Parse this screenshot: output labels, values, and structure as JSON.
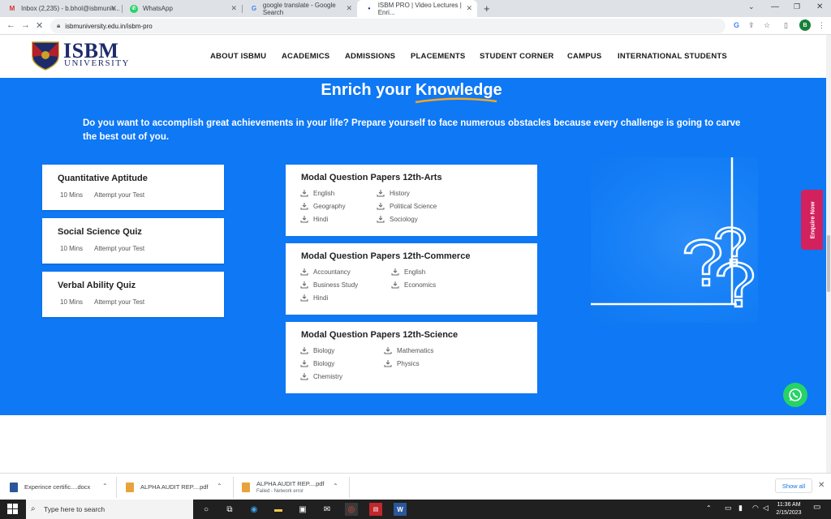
{
  "browser": {
    "tabs": [
      {
        "label": "Inbox (2,235) - b.bhol@isbmuniv...",
        "icon": "gmail-icon"
      },
      {
        "label": "WhatsApp",
        "icon": "whatsapp-icon"
      },
      {
        "label": "google translate - Google Search",
        "icon": "google-icon"
      },
      {
        "label": "ISBM PRO | Video Lectures | Enri...",
        "icon": "isbm-icon"
      }
    ],
    "url": "isbmuniversity.edu.in/isbm-pro",
    "profile_initial": "B"
  },
  "site": {
    "logo_text": "ISBM",
    "logo_sub": "UNIVERSITY",
    "nav": [
      "ABOUT ISBMU",
      "ACADEMICS",
      "ADMISSIONS",
      "PLACEMENTS",
      "STUDENT CORNER",
      "CAMPUS",
      "INTERNATIONAL STUDENTS"
    ]
  },
  "main": {
    "heading_pre": "Enrich your ",
    "heading_word": "Knowledge",
    "intro": "Do you want to accomplish great achievements in your life? Prepare yourself to face numerous obstacles because every challenge is going to carve the best out of you.",
    "quizzes": [
      {
        "title": "Quantitative Aptitude",
        "duration": "10 Mins",
        "action": "Attempt your Test"
      },
      {
        "title": "Social Science Quiz",
        "duration": "10 Mins",
        "action": "Attempt your Test"
      },
      {
        "title": "Verbal Ability Quiz",
        "duration": "10 Mins",
        "action": "Attempt your Test"
      }
    ],
    "papers": [
      {
        "title": "Modal Question Papers 12th-Arts",
        "col1": [
          "English",
          "Geography",
          "Hindi"
        ],
        "col2": [
          "History",
          "Political Science",
          "Sociology"
        ]
      },
      {
        "title": "Modal Question Papers 12th-Commerce",
        "col1": [
          "Accountancy",
          "Business Study",
          "Hindi"
        ],
        "col2": [
          "English",
          "Economics"
        ]
      },
      {
        "title": "Modal Question Papers 12th-Science",
        "col1": [
          "Biology",
          "Biology",
          "Chemistry"
        ],
        "col2": [
          "Mathematics",
          "Physics"
        ]
      }
    ],
    "enquire": "Enquire Now"
  },
  "downloads": {
    "items": [
      {
        "name": "Experince certific....docx",
        "status": ""
      },
      {
        "name": "ALPHA AUDIT REP....pdf",
        "status": ""
      },
      {
        "name": "ALPHA AUDIT REP....pdf",
        "status": "Failed - Network error"
      }
    ],
    "show_all": "Show all"
  },
  "taskbar": {
    "search_placeholder": "Type here to search",
    "time": "11:36 AM",
    "date": "2/15/2023"
  },
  "colors": {
    "accent": "#0e78f5",
    "enquire": "#d3215e",
    "whatsapp": "#25d366",
    "underline": "#f5a623"
  }
}
